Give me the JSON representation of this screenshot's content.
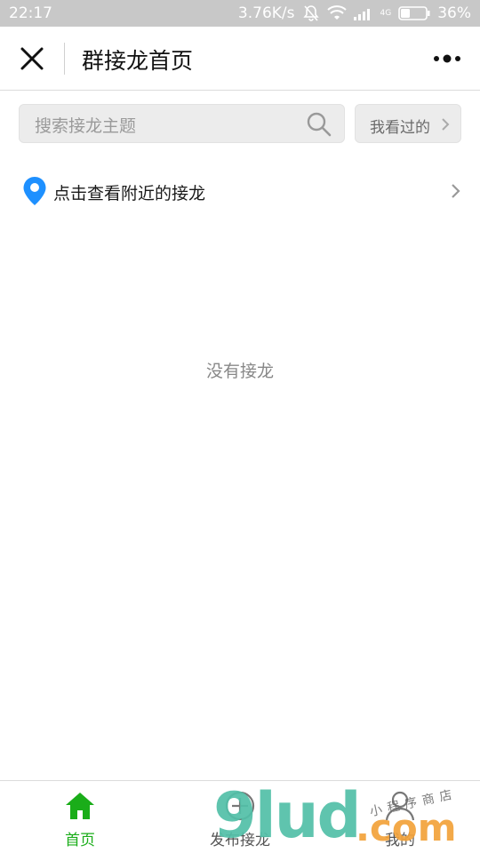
{
  "status_bar": {
    "time": "22:17",
    "net_speed": "3.76K/s",
    "battery": "36%",
    "network": "4G",
    "icons": [
      "bell-off-icon",
      "wifi-icon",
      "signal-icon",
      "battery-icon"
    ]
  },
  "navbar": {
    "title": "群接龙首页",
    "close_icon": "close-icon",
    "more_icon": "more-icon"
  },
  "search": {
    "placeholder": "搜索接龙主题",
    "viewed_label": "我看过的"
  },
  "nearby": {
    "label": "点击查看附近的接龙"
  },
  "main": {
    "empty_text": "没有接龙"
  },
  "tabs": [
    {
      "label": "首页",
      "icon": "home-icon",
      "active": true
    },
    {
      "label": "发布接龙",
      "icon": "plus-circle-icon",
      "active": false
    },
    {
      "label": "我的",
      "icon": "person-icon",
      "active": false
    }
  ],
  "watermark": {
    "big": "9lud",
    "com": ".com",
    "small": "小程序商店"
  },
  "colors": {
    "accent_green": "#1aad19",
    "pin_blue": "#1e90ff",
    "status_bar_bg": "#c8c8c8"
  }
}
